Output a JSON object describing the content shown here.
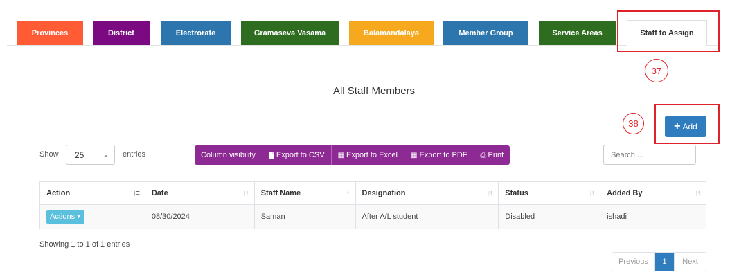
{
  "tabs": [
    {
      "label": "Provinces",
      "color": "#ff5b34"
    },
    {
      "label": "District",
      "color": "#7b0a82"
    },
    {
      "label": "Electrorate",
      "color": "#2d76ad"
    },
    {
      "label": "Gramaseva Vasama",
      "color": "#2e6c1f"
    },
    {
      "label": "Balamandalaya",
      "color": "#f6a91f"
    },
    {
      "label": "Member Group",
      "color": "#2d76ad"
    },
    {
      "label": "Service Areas",
      "color": "#2e6c1f"
    },
    {
      "label": "Staff to Assign",
      "color": "#ffffff",
      "active": true
    }
  ],
  "annotations": {
    "tab_marker": "37",
    "add_marker": "38",
    "color": "#e0232a"
  },
  "page_title": "All Staff Members",
  "add_button": {
    "label": "Add",
    "icon": "plus-icon",
    "color": "#2f7dbf"
  },
  "length_menu": {
    "show_label": "Show",
    "selected": "25",
    "entries_label": "entries"
  },
  "export_buttons": [
    {
      "label": "Column visibility",
      "icon": ""
    },
    {
      "label": "Export to CSV",
      "icon": "file-icon"
    },
    {
      "label": "Export to Excel",
      "icon": "excel-file-icon"
    },
    {
      "label": "Export to PDF",
      "icon": "pdf-file-icon"
    },
    {
      "label": "Print",
      "icon": "print-icon"
    }
  ],
  "export_color": "#8d2a93",
  "search": {
    "placeholder": "Search ..."
  },
  "table": {
    "headers": [
      "Action",
      "Date",
      "Staff Name",
      "Designation",
      "Status",
      "Added By"
    ],
    "rows": [
      {
        "action_label": "Actions",
        "date": "08/30/2024",
        "staff_name": "Saman",
        "designation": "After A/L student",
        "status": "Disabled",
        "added_by": "ishadi"
      }
    ]
  },
  "info_text": "Showing 1 to 1 of 1 entries",
  "pagination": {
    "previous": "Previous",
    "current": "1",
    "next": "Next"
  }
}
